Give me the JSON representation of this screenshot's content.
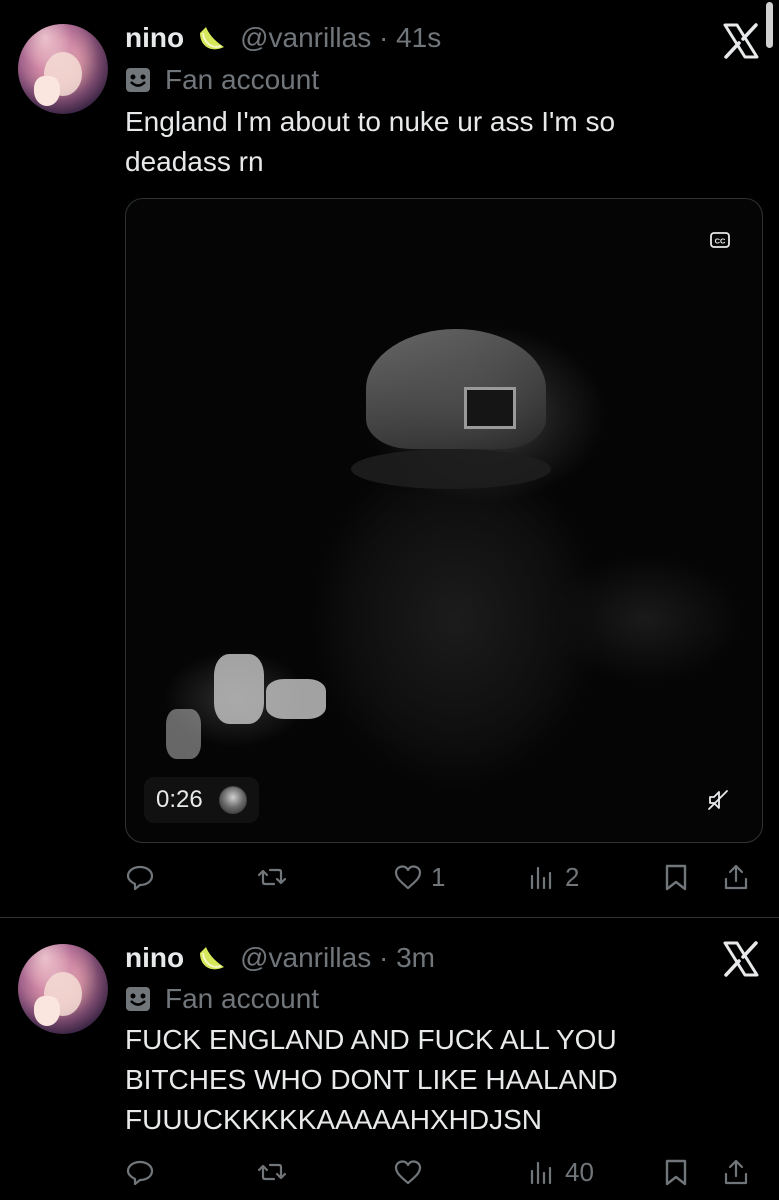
{
  "tweets": [
    {
      "author_name": "nino",
      "verified_badge_icon": "lime-slice-icon",
      "handle_time": "@vanrillas · 41s",
      "affiliation": "Fan account",
      "text": "England I'm about to nuke ur ass I'm so deadass rn",
      "media": {
        "duration": "0:26",
        "cc_icon": "closed-captions-icon",
        "mute_icon": "muted-speaker-icon"
      },
      "actions": {
        "reply_count": "",
        "retweet_count": "",
        "like_count": "1",
        "views_count": "2"
      }
    },
    {
      "author_name": "nino",
      "verified_badge_icon": "lime-slice-icon",
      "handle_time": "@vanrillas · 3m",
      "affiliation": "Fan account",
      "text": "FUCK ENGLAND AND FUCK ALL YOU BITCHES WHO DONT LIKE HAALAND FUUUCKKKKKAAAAAHXHDJSN",
      "actions": {
        "reply_count": "",
        "retweet_count": "",
        "like_count": "",
        "views_count": "40"
      }
    }
  ],
  "colors": {
    "background": "#000000",
    "primary_text": "#e7e9ea",
    "secondary_text": "#71767b",
    "divider": "#2f3336",
    "lime_badge": "#d6e85a"
  },
  "icons": [
    "x-logo-icon",
    "comedy-mask-icon",
    "reply-icon",
    "retweet-icon",
    "heart-icon",
    "views-icon",
    "bookmark-icon",
    "share-icon"
  ]
}
